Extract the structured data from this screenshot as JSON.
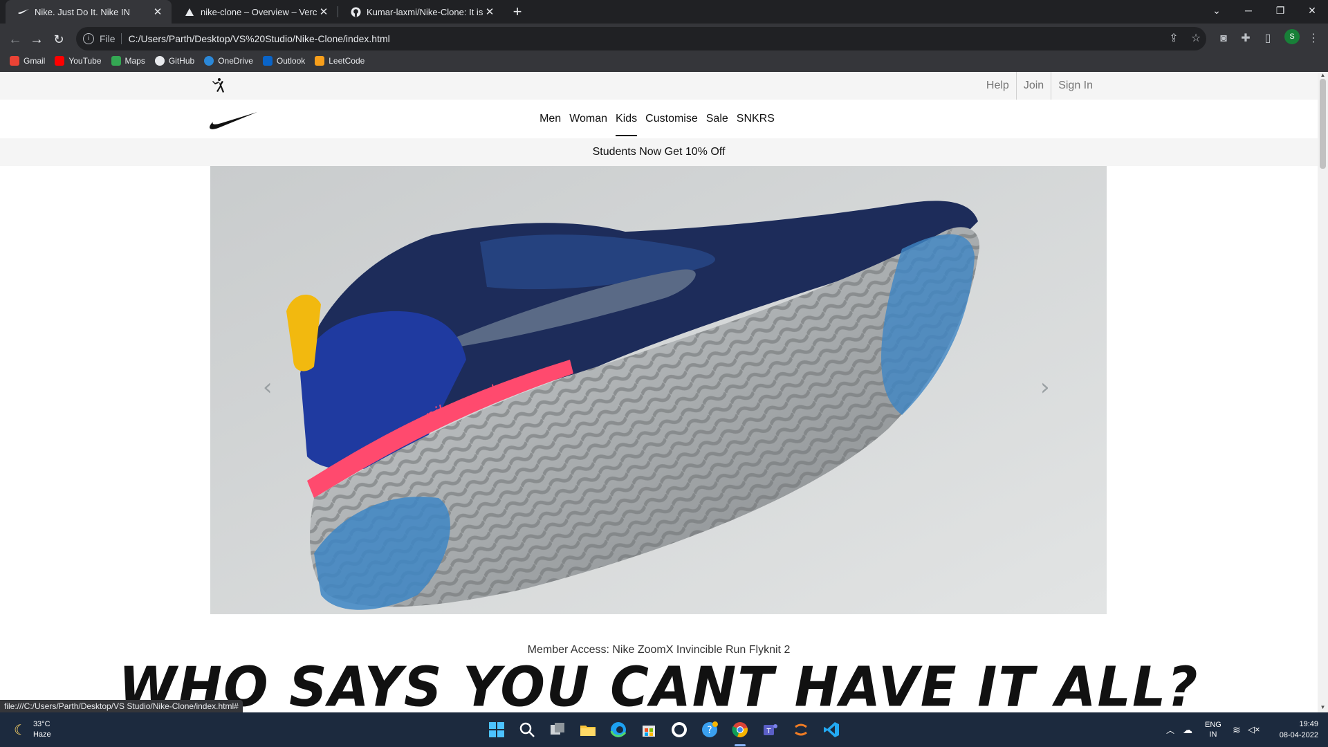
{
  "browser": {
    "tabs": [
      {
        "title": "Nike. Just Do It. Nike IN",
        "active": true
      },
      {
        "title": "nike-clone – Overview – Vercel",
        "active": false
      },
      {
        "title": "Kumar-laxmi/Nike-Clone: It is a C",
        "active": false
      }
    ],
    "url_scheme": "File",
    "url": "C:/Users/Parth/Desktop/VS%20Studio/Nike-Clone/index.html",
    "profile_initial": "S",
    "bookmarks": [
      "Gmail",
      "YouTube",
      "Maps",
      "GitHub",
      "OneDrive",
      "Outlook",
      "LeetCode"
    ],
    "status_url": "file:///C:/Users/Parth/Desktop/VS Studio/Nike-Clone/index.html#"
  },
  "site": {
    "util_links": [
      "Help",
      "Join",
      "Sign In"
    ],
    "nav": [
      "Men",
      "Woman",
      "Kids",
      "Customise",
      "Sale",
      "SNKRS"
    ],
    "active_nav": "Kids",
    "promo": "Students Now Get 10% Off",
    "hero_brand_text": "nike react",
    "member_access": "Member Access: Nike ZoomX Invincible Run Flyknit 2",
    "headline": "WHO SAYS YOU CANT HAVE IT ALL?"
  },
  "taskbar": {
    "temp": "33°C",
    "condition": "Haze",
    "lang_top": "ENG",
    "lang_bottom": "IN",
    "time": "19:49",
    "date": "08-04-2022"
  },
  "colors": {
    "chrome_dark": "#202124",
    "chrome_toolbar": "#35363a",
    "taskbar": "#1c2a3e",
    "shoe_upper": "#1d2c5a",
    "shoe_heel": "#1f3aa0",
    "shoe_accent": "#ff4a6e",
    "pull_tab": "#f2b90f"
  }
}
